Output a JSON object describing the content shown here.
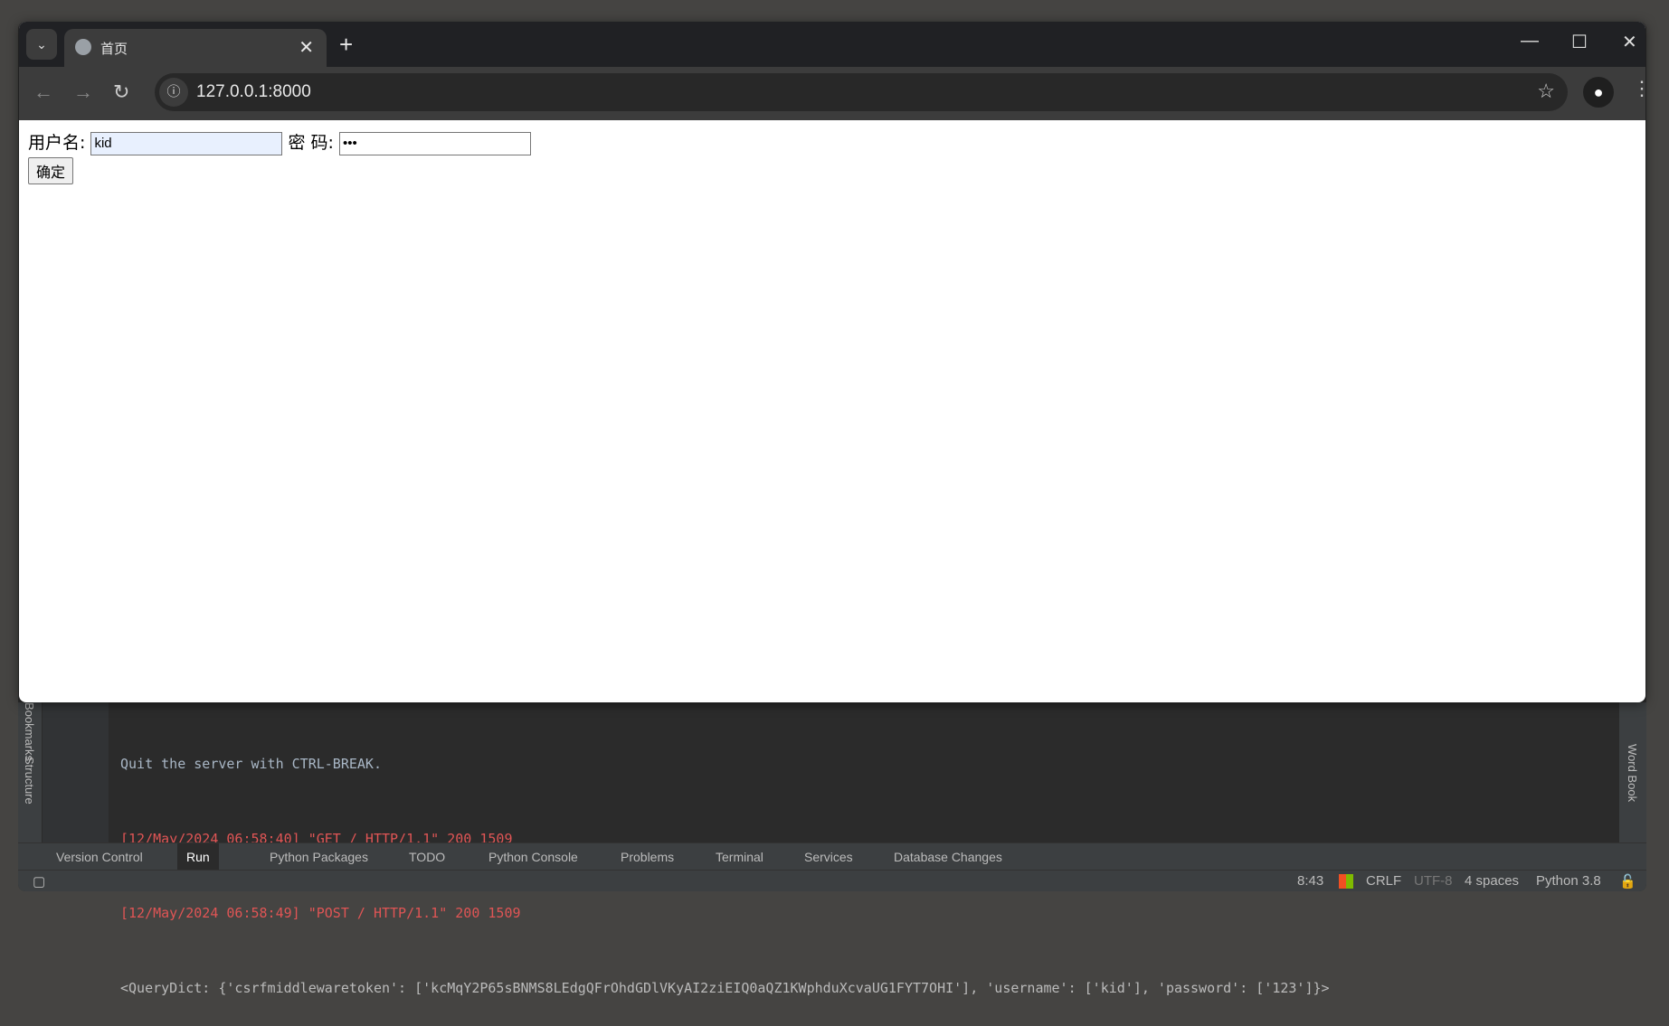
{
  "browser": {
    "tab_title": "首页",
    "url": "127.0.0.1:8000",
    "icons": [
      "chevron-down-icon",
      "globe-icon",
      "close-icon",
      "plus-icon",
      "minimize-icon",
      "maximize-icon",
      "window-close-icon",
      "back-icon",
      "forward-icon",
      "reload-icon",
      "info-icon",
      "star-icon",
      "profile-icon",
      "menu-icon"
    ]
  },
  "form": {
    "username_label": "用户名:",
    "username_value": "kid",
    "password_label": "密 码:",
    "password_value": "123",
    "submit_label": "确定"
  },
  "ide": {
    "left_strip": [
      "Bookmarks",
      "Structure"
    ],
    "right_strip": [
      "Word Book"
    ],
    "console": [
      {
        "text": "Quit the server with CTRL-BREAK.",
        "color": "#a9b7c6"
      },
      {
        "text": "[12/May/2024 06:58:40] \"GET / HTTP/1.1\" 200 1509",
        "color": "#e05555"
      },
      {
        "text": "[12/May/2024 06:58:49] \"POST / HTTP/1.1\" 200 1509",
        "color": "#e05555"
      },
      {
        "text": "<QueryDict: {'csrfmiddlewaretoken': ['kcMqY2P65sBNMS8LEdgQFrOhdGDlVKyAI2ziEIQ0aQZ1KWphduXcvaUG1FYT7OHI'], 'username': ['kid'], 'password': ['123']}>",
        "color": "#bbbbbb"
      }
    ],
    "tool_windows": [
      "Version Control",
      "Run",
      "Python Packages",
      "TODO",
      "Python Console",
      "Problems",
      "Terminal",
      "Services",
      "Database Changes"
    ],
    "active_tool_window": "Run",
    "status": {
      "position": "8:43",
      "line_ending": "CRLF",
      "encoding": "UTF-8",
      "indent": "4 spaces",
      "interpreter": "Python 3.8"
    }
  }
}
